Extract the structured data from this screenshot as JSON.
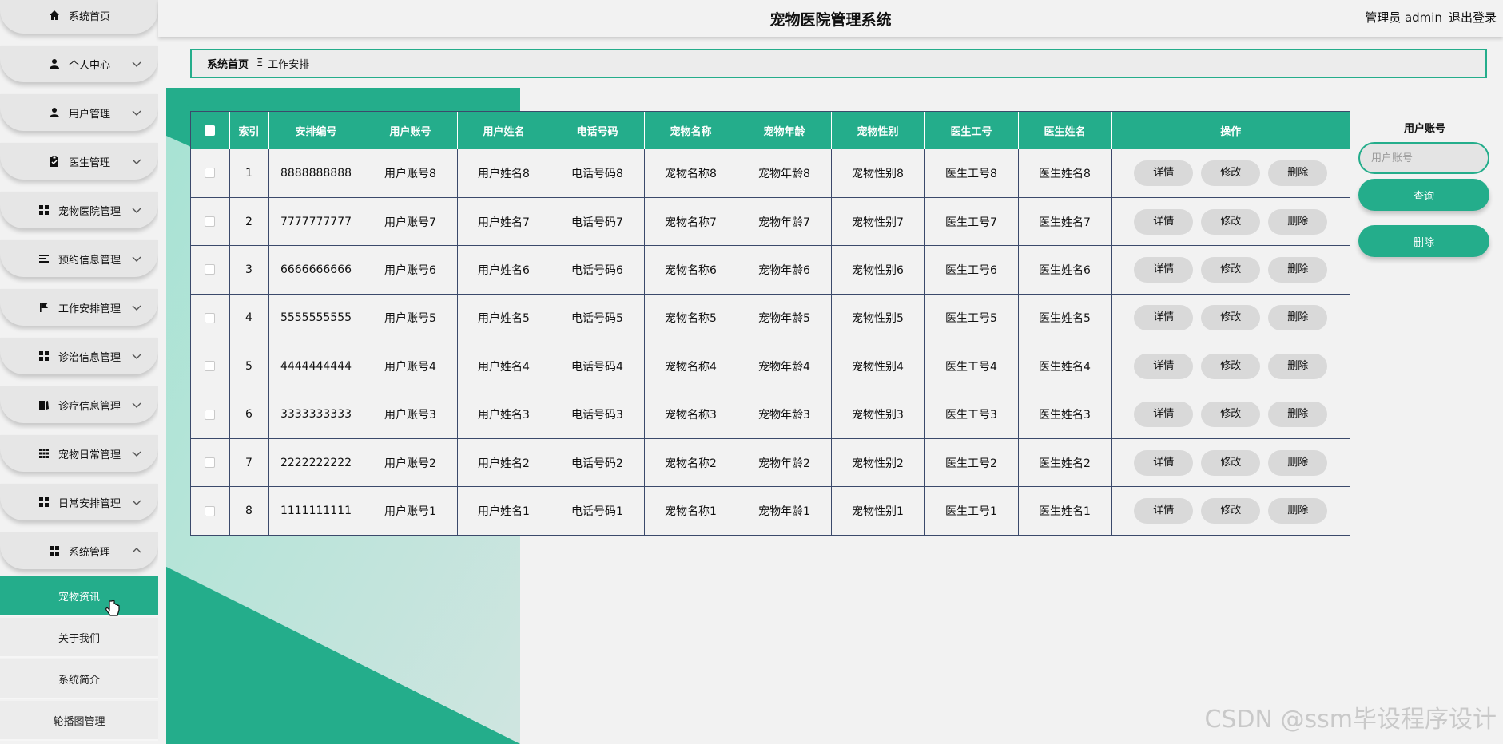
{
  "header": {
    "title": "宠物医院管理系统",
    "user_role": "管理员 admin",
    "logout": "退出登录"
  },
  "sidebar": {
    "items": [
      {
        "label": "系统首页",
        "icon": "home-icon"
      },
      {
        "label": "个人中心",
        "icon": "user-icon"
      },
      {
        "label": "用户管理",
        "icon": "user-icon"
      },
      {
        "label": "医生管理",
        "icon": "clipboard-icon"
      },
      {
        "label": "宠物医院管理",
        "icon": "grid-icon"
      },
      {
        "label": "预约信息管理",
        "icon": "list-icon"
      },
      {
        "label": "工作安排管理",
        "icon": "flag-icon"
      },
      {
        "label": "诊治信息管理",
        "icon": "grid-icon"
      },
      {
        "label": "诊疗信息管理",
        "icon": "book-icon"
      },
      {
        "label": "宠物日常管理",
        "icon": "grid9-icon"
      },
      {
        "label": "日常安排管理",
        "icon": "grid-icon"
      },
      {
        "label": "系统管理",
        "icon": "grid-icon"
      }
    ],
    "sub_items": [
      {
        "label": "宠物资讯"
      },
      {
        "label": "关于我们"
      },
      {
        "label": "系统简介"
      },
      {
        "label": "轮播图管理"
      }
    ]
  },
  "breadcrumb": {
    "home": "系统首页",
    "separator": "Ξ",
    "current": "工作安排"
  },
  "table": {
    "headers": [
      "索引",
      "安排编号",
      "用户账号",
      "用户姓名",
      "电话号码",
      "宠物名称",
      "宠物年龄",
      "宠物性别",
      "医生工号",
      "医生姓名",
      "操作"
    ],
    "rows": [
      [
        "1",
        "8888888888",
        "用户账号8",
        "用户姓名8",
        "电话号码8",
        "宠物名称8",
        "宠物年龄8",
        "宠物性别8",
        "医生工号8",
        "医生姓名8"
      ],
      [
        "2",
        "7777777777",
        "用户账号7",
        "用户姓名7",
        "电话号码7",
        "宠物名称7",
        "宠物年龄7",
        "宠物性别7",
        "医生工号7",
        "医生姓名7"
      ],
      [
        "3",
        "6666666666",
        "用户账号6",
        "用户姓名6",
        "电话号码6",
        "宠物名称6",
        "宠物年龄6",
        "宠物性别6",
        "医生工号6",
        "医生姓名6"
      ],
      [
        "4",
        "5555555555",
        "用户账号5",
        "用户姓名5",
        "电话号码5",
        "宠物名称5",
        "宠物年龄5",
        "宠物性别5",
        "医生工号5",
        "医生姓名5"
      ],
      [
        "5",
        "4444444444",
        "用户账号4",
        "用户姓名4",
        "电话号码4",
        "宠物名称4",
        "宠物年龄4",
        "宠物性别4",
        "医生工号4",
        "医生姓名4"
      ],
      [
        "6",
        "3333333333",
        "用户账号3",
        "用户姓名3",
        "电话号码3",
        "宠物名称3",
        "宠物年龄3",
        "宠物性别3",
        "医生工号3",
        "医生姓名3"
      ],
      [
        "7",
        "2222222222",
        "用户账号2",
        "用户姓名2",
        "电话号码2",
        "宠物名称2",
        "宠物年龄2",
        "宠物性别2",
        "医生工号2",
        "医生姓名2"
      ],
      [
        "8",
        "1111111111",
        "用户账号1",
        "用户姓名1",
        "电话号码1",
        "宠物名称1",
        "宠物年龄1",
        "宠物性别1",
        "医生工号1",
        "医生姓名1"
      ]
    ],
    "actions": [
      "详情",
      "修改",
      "删除"
    ]
  },
  "search": {
    "label": "用户账号",
    "placeholder": "用户账号",
    "query_button": "查询",
    "delete_button": "删除"
  },
  "watermark": "CSDN @ssm毕设程序设计",
  "colors": {
    "accent": "#24ad8b",
    "background": "#f2f2f2",
    "border": "#3b4a6b"
  }
}
